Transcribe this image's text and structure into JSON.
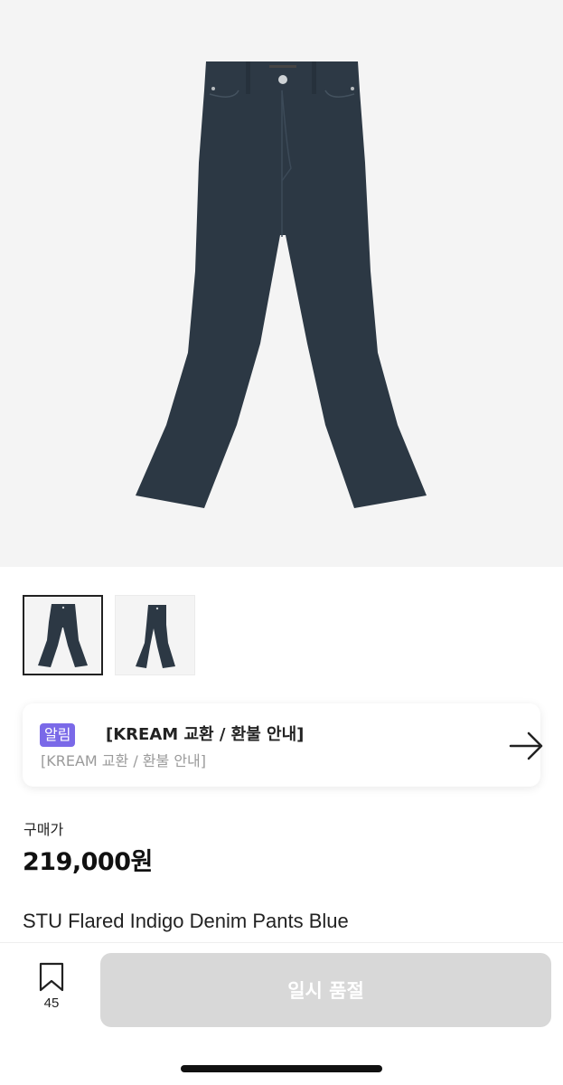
{
  "product": {
    "main_image_alt": "indigo flared denim pants",
    "thumbnails": [
      {
        "name": "front",
        "selected": true
      },
      {
        "name": "side",
        "selected": false
      }
    ]
  },
  "notice": {
    "badge": "알림",
    "title": "[KREAM 교환 / 환불 안내]",
    "subtitle": "[KREAM 교환 / 환불 안내]",
    "icon": "arrow-right-icon"
  },
  "price": {
    "label": "구매가",
    "value": "219,000원"
  },
  "product_name": "STU Flared Indigo Denim Pants Blue",
  "bottom_bar": {
    "wishlist_icon": "bookmark-icon",
    "wishlist_count": "45",
    "buy_button_label": "일시 품절"
  },
  "colors": {
    "denim": "#2c3844",
    "badge": "#7a69e8",
    "disabled_button": "#d8d8d8",
    "hero_bg": "#f4f4f4"
  }
}
